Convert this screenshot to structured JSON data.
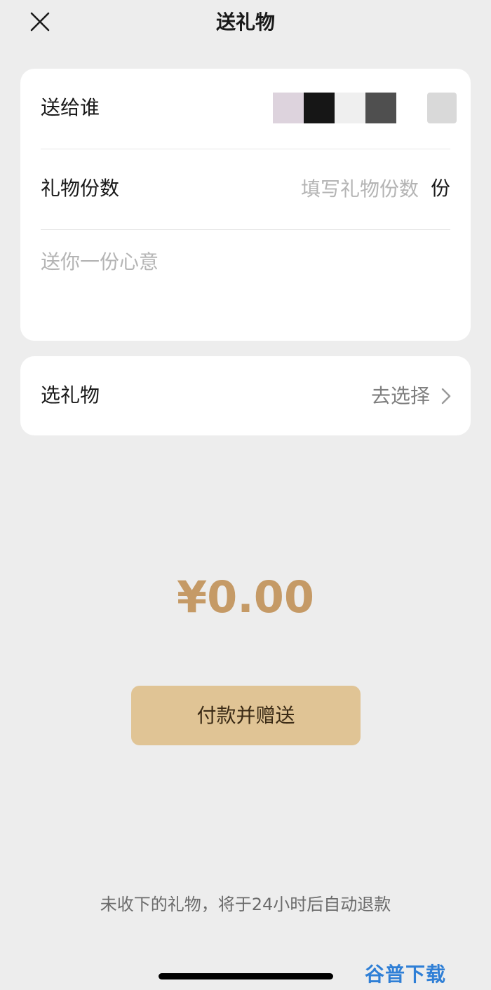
{
  "nav": {
    "title": "送礼物",
    "close_icon": "close-icon"
  },
  "recipient": {
    "label": "送给谁"
  },
  "quantity": {
    "label": "礼物份数",
    "placeholder": "填写礼物份数",
    "value": "",
    "unit": "份"
  },
  "message": {
    "placeholder": "送你一份心意",
    "value": ""
  },
  "gift_select": {
    "label": "选礼物",
    "action": "去选择",
    "icon": "chevron-right-icon"
  },
  "amount": "¥0.00",
  "pay_button": "付款并赠送",
  "footer_note": "未收下的礼物，将于24小时后自动退款",
  "watermark": "谷普下载",
  "colors": {
    "background": "#ededed",
    "amount": "#c59a66",
    "pay_button": "#e0c495",
    "watermark": "#2f7fd6"
  }
}
